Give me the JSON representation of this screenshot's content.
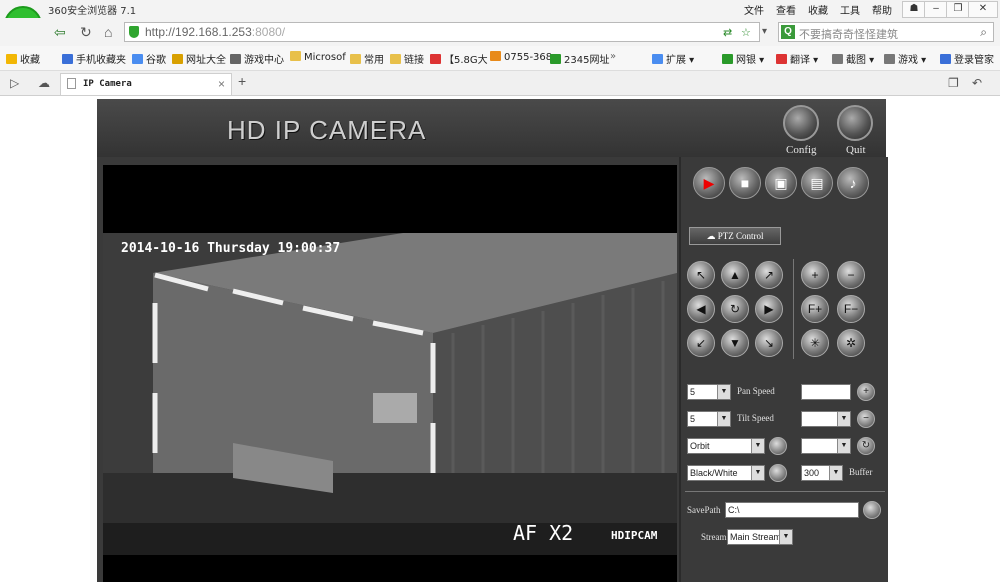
{
  "browser": {
    "title": "360安全浏览器 7.1",
    "menu": [
      "文件",
      "查看",
      "收藏",
      "工具",
      "帮助"
    ],
    "url_main": "http://192.168.1.253",
    "url_port": ":8080/",
    "search_placeholder": "不要搞奇奇怪怪建筑",
    "bookmarks": [
      "收藏",
      "手机收藏夹",
      "谷歌",
      "网址大全",
      "游戏中心",
      "Microsof",
      "常用",
      "链接",
      "【5.8G大",
      "0755-368",
      "2345网址"
    ],
    "right_bookmarks": [
      "扩展",
      "网银",
      "翻译",
      "截图",
      "游戏",
      "登录管家"
    ],
    "tab_title": "IP Camera"
  },
  "camera": {
    "title": "HD IP CAMERA",
    "config_label": "Config",
    "quit_label": "Quit",
    "timestamp": "2014-10-16 Thursday 19:00:37",
    "af_zoom": "AF X2",
    "brand": "HDIPCAM",
    "ptz_label": "PTZ Control",
    "pan_speed_value": "5",
    "pan_speed_label": "Pan Speed",
    "tilt_speed_value": "5",
    "tilt_speed_label": "Tilt Speed",
    "mode_value": "Orbit",
    "color_value": "Black/White",
    "buffer_value": "300",
    "buffer_label": "Buffer",
    "savepath_label": "SavePath",
    "savepath_value": "C:\\",
    "stream_label": "Stream",
    "stream_value": "Main Stream"
  }
}
